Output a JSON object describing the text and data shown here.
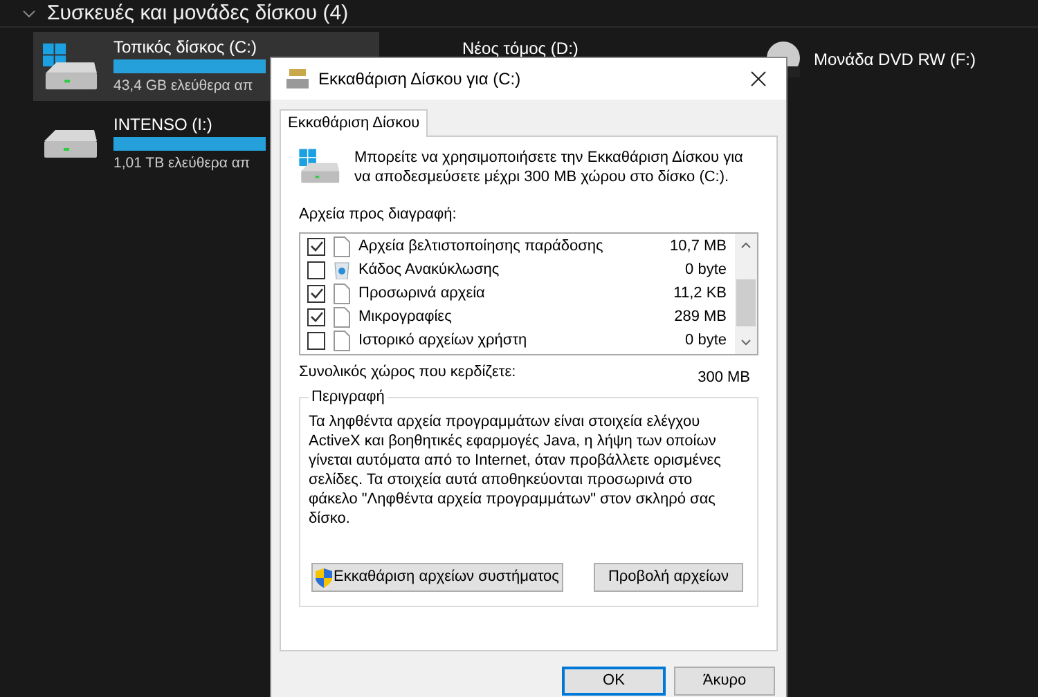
{
  "explorer": {
    "section": {
      "title": "Συσκευές και μονάδες δίσκου (4)",
      "expanded": true
    },
    "drives": [
      {
        "kind": "system",
        "name": "Τοπικός δίσκος (C:)",
        "free": "43,4 GB ελεύθερα απ",
        "selected": true
      },
      {
        "kind": "disk",
        "name": "INTENSO (I:)",
        "free": "1,01 TB ελεύθερα απ",
        "selected": false
      },
      {
        "kind": "label",
        "name": "Νέος τόμος (D:)",
        "selected": false
      },
      {
        "kind": "dvd",
        "name": "Μονάδα DVD RW (F:)",
        "selected": false
      }
    ]
  },
  "dialog": {
    "title": "Εκκαθάριση Δίσκου για  (C:)",
    "tabs": [
      {
        "label": "Εκκαθάριση Δίσκου",
        "selected": true
      }
    ],
    "intro": "Μπορείτε να χρησιμοποιήσετε την Εκκαθάριση Δίσκου για να αποδεσμεύσετε μέχρι 300 MB χώρου στο δίσκο  (C:).",
    "files_label": "Αρχεία προς διαγραφή:",
    "files": [
      {
        "kind": "file",
        "name": "Αρχεία βελτιστοποίησης παράδοσης",
        "size": "10,7 MB",
        "checked": true
      },
      {
        "kind": "recycle",
        "name": "Κάδος Ανακύκλωσης",
        "size": "0 byte",
        "checked": false
      },
      {
        "kind": "file",
        "name": "Προσωρινά αρχεία",
        "size": "11,2 KB",
        "checked": true
      },
      {
        "kind": "file",
        "name": "Μικρογραφίες",
        "size": "289 MB",
        "checked": true
      },
      {
        "kind": "file",
        "name": "Ιστορικό αρχείων χρήστη",
        "size": "0 byte",
        "checked": false
      }
    ],
    "total_label": "Συνολικός χώρος που κερδίζετε:",
    "total": "300 MB",
    "description_title": "Περιγραφή",
    "description": "Τα ληφθέντα αρχεία προγραμμάτων είναι στοιχεία ελέγχου ActiveX και βοηθητικές εφαρμογές Java, η λήψη των οποίων γίνεται αυτόματα από το Internet, όταν προβάλλετε ορισμένες σελίδες. Τα στοιχεία αυτά αποθηκεύονται προσωρινά στο φάκελο \"Ληφθέντα αρχεία προγραμμάτων\" στον σκληρό σας δίσκο.",
    "clean_system_button": "Εκκαθάριση αρχείων συστήματος",
    "view_files_button": "Προβολή αρχείων",
    "ok_button": "OK",
    "cancel_button": "Άκυρο"
  }
}
